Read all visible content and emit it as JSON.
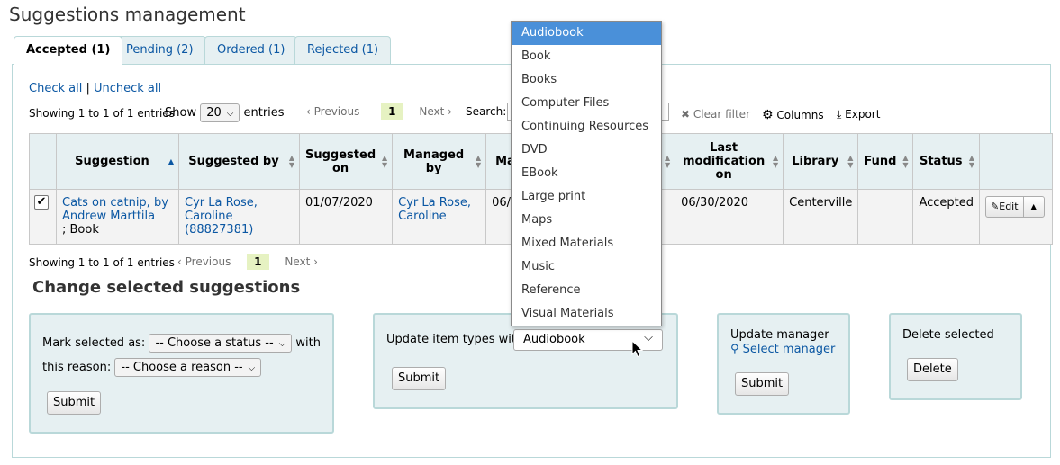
{
  "page_title": "Suggestions management",
  "tabs": [
    {
      "label": "Accepted (1)"
    },
    {
      "label": "Pending (2)"
    },
    {
      "label": "Ordered (1)"
    },
    {
      "label": "Rejected (1)"
    }
  ],
  "check_all": "Check all",
  "separator": "|",
  "uncheck_all": "Uncheck all",
  "info_top": "Showing 1 to 1 of 1 entries",
  "info_bottom": "Showing 1 to 1 of 1 entries",
  "length": {
    "show": "Show",
    "value": "20",
    "entries": "entries"
  },
  "pager": {
    "previous": "Previous",
    "page": "1",
    "next": "Next"
  },
  "search_label": "Search:",
  "toolbar": {
    "clear_filter": "Clear filter",
    "columns": "Columns",
    "export": "Export"
  },
  "columns": [
    "Suggestion",
    "Suggested by",
    "Suggested on",
    "Managed by",
    "Mar",
    "Last modification on",
    "Library",
    "Fund",
    "Status"
  ],
  "row": {
    "title_link": "Cats on catnip, by Andrew Marttila",
    "title_suffix": "; Book",
    "suggested_by": "Cyr La Rose, Caroline (88827381)",
    "suggested_on": "01/07/2020",
    "managed_by": "Cyr La Rose, Caroline",
    "managed_on_partial": "06/3",
    "last_modification": "06/30/2020",
    "library": "Centerville",
    "fund": "",
    "status": "Accepted",
    "edit": "Edit"
  },
  "change_heading": "Change selected suggestions",
  "mark": {
    "label": "Mark selected as:",
    "status_value": "-- Choose a status --",
    "with": "with",
    "reason_label": "this reason:",
    "reason_value": "-- Choose a reason --",
    "submit": "Submit"
  },
  "itemtype": {
    "label": "Update item types with:",
    "value": "Audiobook",
    "submit": "Submit"
  },
  "manager": {
    "label": "Update manager",
    "select": "Select manager",
    "submit": "Submit"
  },
  "delete": {
    "label": "Delete selected",
    "button": "Delete"
  },
  "dropdown_options": [
    "Audiobook",
    "Book",
    "Books",
    "Computer Files",
    "Continuing Resources",
    "DVD",
    "EBook",
    "Large print",
    "Maps",
    "Mixed Materials",
    "Music",
    "Reference",
    "Visual Materials"
  ],
  "dropdown_highlighted": "Audiobook",
  "icons": {
    "clear": "close-icon",
    "columns": "gear-icon",
    "export": "download-icon",
    "edit": "pencil-icon",
    "search_manager": "search-icon",
    "caret": "chevron-down-icon"
  },
  "colors": {
    "link": "#0b57a3",
    "tab_bg": "#e6f0f2",
    "border": "#b9d8d9",
    "highlight": "#4a90d9",
    "page_current": "#e6f2c2"
  }
}
